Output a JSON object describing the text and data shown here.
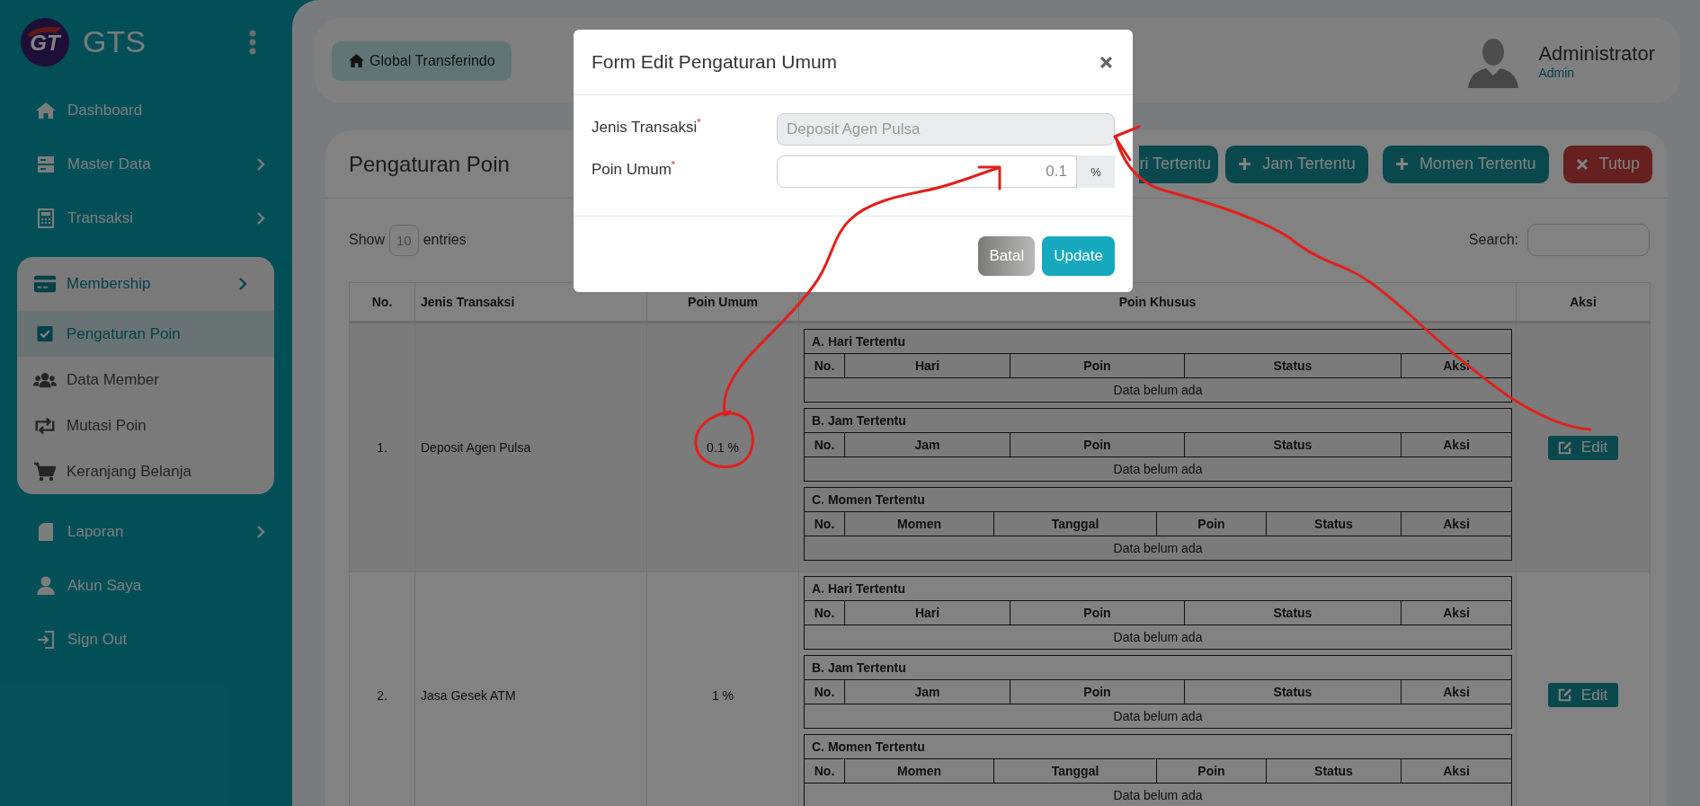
{
  "sidebar": {
    "brand": "GTS",
    "logo_text": "GT",
    "items": [
      {
        "label": "Dashboard",
        "expandable": false,
        "selected": false
      },
      {
        "label": "Master Data",
        "expandable": true,
        "selected": false
      },
      {
        "label": "Transaksi",
        "expandable": true,
        "selected": false
      },
      {
        "label": "Membership",
        "expandable": true,
        "selected": true,
        "children": [
          {
            "label": "Pengaturan Poin",
            "selected": true
          },
          {
            "label": "Data Member",
            "selected": false
          },
          {
            "label": "Mutasi Poin",
            "selected": false
          },
          {
            "label": "Keranjang Belanja",
            "selected": false
          }
        ]
      },
      {
        "label": "Laporan",
        "expandable": true,
        "selected": false
      },
      {
        "label": "Akun Saya",
        "expandable": false,
        "selected": false
      },
      {
        "label": "Sign Out",
        "expandable": false,
        "selected": false
      }
    ]
  },
  "header": {
    "home_button": "Global Transferindo",
    "user": {
      "name": "Administrator",
      "role": "Admin"
    }
  },
  "page": {
    "title": "Pengaturan Poin",
    "buttons": [
      {
        "label": "ri Tertentu",
        "kind": "partial"
      },
      {
        "label": "Jam Tertentu",
        "kind": "add"
      },
      {
        "label": "Momen Tertentu",
        "kind": "add"
      },
      {
        "label": "Tutup",
        "kind": "close"
      }
    ]
  },
  "table_controls": {
    "show": "Show",
    "page_size": "10",
    "entries": "entries",
    "search_label": "Search:"
  },
  "table": {
    "columns": [
      "No.",
      "Jenis Transaksi",
      "Poin Umum",
      "Poin Khusus",
      "Aksi"
    ],
    "rows": [
      {
        "no": "1.",
        "jenis": "Deposit Agen Pulsa",
        "poin_umum": "0.1 %",
        "action": "Edit",
        "sections": [
          {
            "title": "A. Hari Tertentu",
            "columns": [
              "No.",
              "Hari",
              "Poin",
              "Status",
              "Aksi"
            ],
            "empty": "Data belum ada"
          },
          {
            "title": "B. Jam Tertentu",
            "columns": [
              "No.",
              "Jam",
              "Poin",
              "Status",
              "Aksi"
            ],
            "empty": "Data belum ada"
          },
          {
            "title": "C. Momen Tertentu",
            "columns": [
              "No.",
              "Momen",
              "Tanggal",
              "Poin",
              "Status",
              "Aksi"
            ],
            "empty": "Data belum ada"
          }
        ]
      },
      {
        "no": "2.",
        "jenis": "Jasa Gesek ATM",
        "poin_umum": "1 %",
        "action": "Edit",
        "sections": [
          {
            "title": "A. Hari Tertentu",
            "columns": [
              "No.",
              "Hari",
              "Poin",
              "Status",
              "Aksi"
            ],
            "empty": "Data belum ada"
          },
          {
            "title": "B. Jam Tertentu",
            "columns": [
              "No.",
              "Jam",
              "Poin",
              "Status",
              "Aksi"
            ],
            "empty": "Data belum ada"
          },
          {
            "title": "C. Momen Tertentu",
            "columns": [
              "No.",
              "Momen",
              "Tanggal",
              "Poin",
              "Status",
              "Aksi"
            ],
            "empty": "Data belum ada"
          }
        ]
      }
    ]
  },
  "modal": {
    "title": "Form Edit Pengaturan Umum",
    "fields": [
      {
        "label": "Jenis Transaksi",
        "required_mark": "*",
        "value": "Deposit Agen Pulsa",
        "disabled": true
      },
      {
        "label": "Poin Umum",
        "required_mark": "*",
        "placeholder": "0.1",
        "addon": "%",
        "disabled": false
      }
    ],
    "buttons": [
      {
        "label": "Batal",
        "kind": "cancel"
      },
      {
        "label": "Update",
        "kind": "primary"
      }
    ]
  }
}
